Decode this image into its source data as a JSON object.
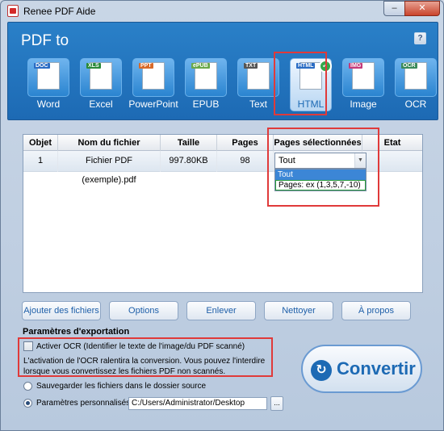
{
  "window": {
    "title": "Renee PDF Aide",
    "min": "–",
    "close": "✕"
  },
  "header": {
    "pdf_to": "PDF to",
    "help": "?"
  },
  "formats": [
    {
      "id": "word",
      "tag": "DOC",
      "tag_color": "#2a6cc4",
      "label": "Word",
      "selected": false,
      "icon": "word-icon"
    },
    {
      "id": "excel",
      "tag": "XLS",
      "tag_color": "#2a8a3a",
      "label": "Excel",
      "selected": false,
      "icon": "excel-icon"
    },
    {
      "id": "powerpoint",
      "tag": "PPT",
      "tag_color": "#d86a2a",
      "label": "PowerPoint",
      "selected": false,
      "icon": "powerpoint-icon"
    },
    {
      "id": "epub",
      "tag": "ePUB",
      "tag_color": "#6aa84a",
      "label": "EPUB",
      "selected": false,
      "icon": "epub-icon"
    },
    {
      "id": "text",
      "tag": "TXT",
      "tag_color": "#555555",
      "label": "Text",
      "selected": false,
      "icon": "text-icon"
    },
    {
      "id": "html",
      "tag": "HTML",
      "tag_color": "#2a6cc4",
      "label": "HTML",
      "selected": true,
      "icon": "html-icon"
    },
    {
      "id": "image",
      "tag": "IMG",
      "tag_color": "#c43a7a",
      "label": "Image",
      "selected": false,
      "icon": "image-icon"
    },
    {
      "id": "ocr",
      "tag": "OCR",
      "tag_color": "#3a8a5a",
      "label": "OCR",
      "selected": false,
      "icon": "ocr-icon"
    }
  ],
  "table": {
    "headers": [
      "Objet",
      "Nom du fichier",
      "Taille",
      "Pages totales",
      "Pages sélectionnées",
      "Etat"
    ],
    "rows": [
      {
        "objet": "1",
        "nom": "Fichier PDF (exemple).pdf",
        "taille": "997.80KB",
        "pages_totales": "98",
        "etat": ""
      }
    ]
  },
  "pages_select": {
    "value": "Tout",
    "options": [
      "Tout",
      "Pages: ex (1,3,5,7,-10)"
    ]
  },
  "buttons": {
    "add": "Ajouter des fichiers",
    "options": "Options",
    "remove": "Enlever",
    "clean": "Nettoyer",
    "about": "À propos"
  },
  "export": {
    "label": "Paramètres d'exportation",
    "ocr_checkbox": "Activer OCR (Identifier le texte de l'image/du PDF scanné)",
    "ocr_note": "L'activation de l'OCR ralentira la conversion. Vous pouvez l'interdire lorsque vous convertissez les fichiers PDF non scannés.",
    "radio_source": "Sauvegarder les fichiers dans le dossier source",
    "radio_custom": "Paramètres personnalisés",
    "path": "C:/Users/Administrator/Desktop",
    "browse": "..."
  },
  "convert": {
    "label": "Convertir"
  }
}
